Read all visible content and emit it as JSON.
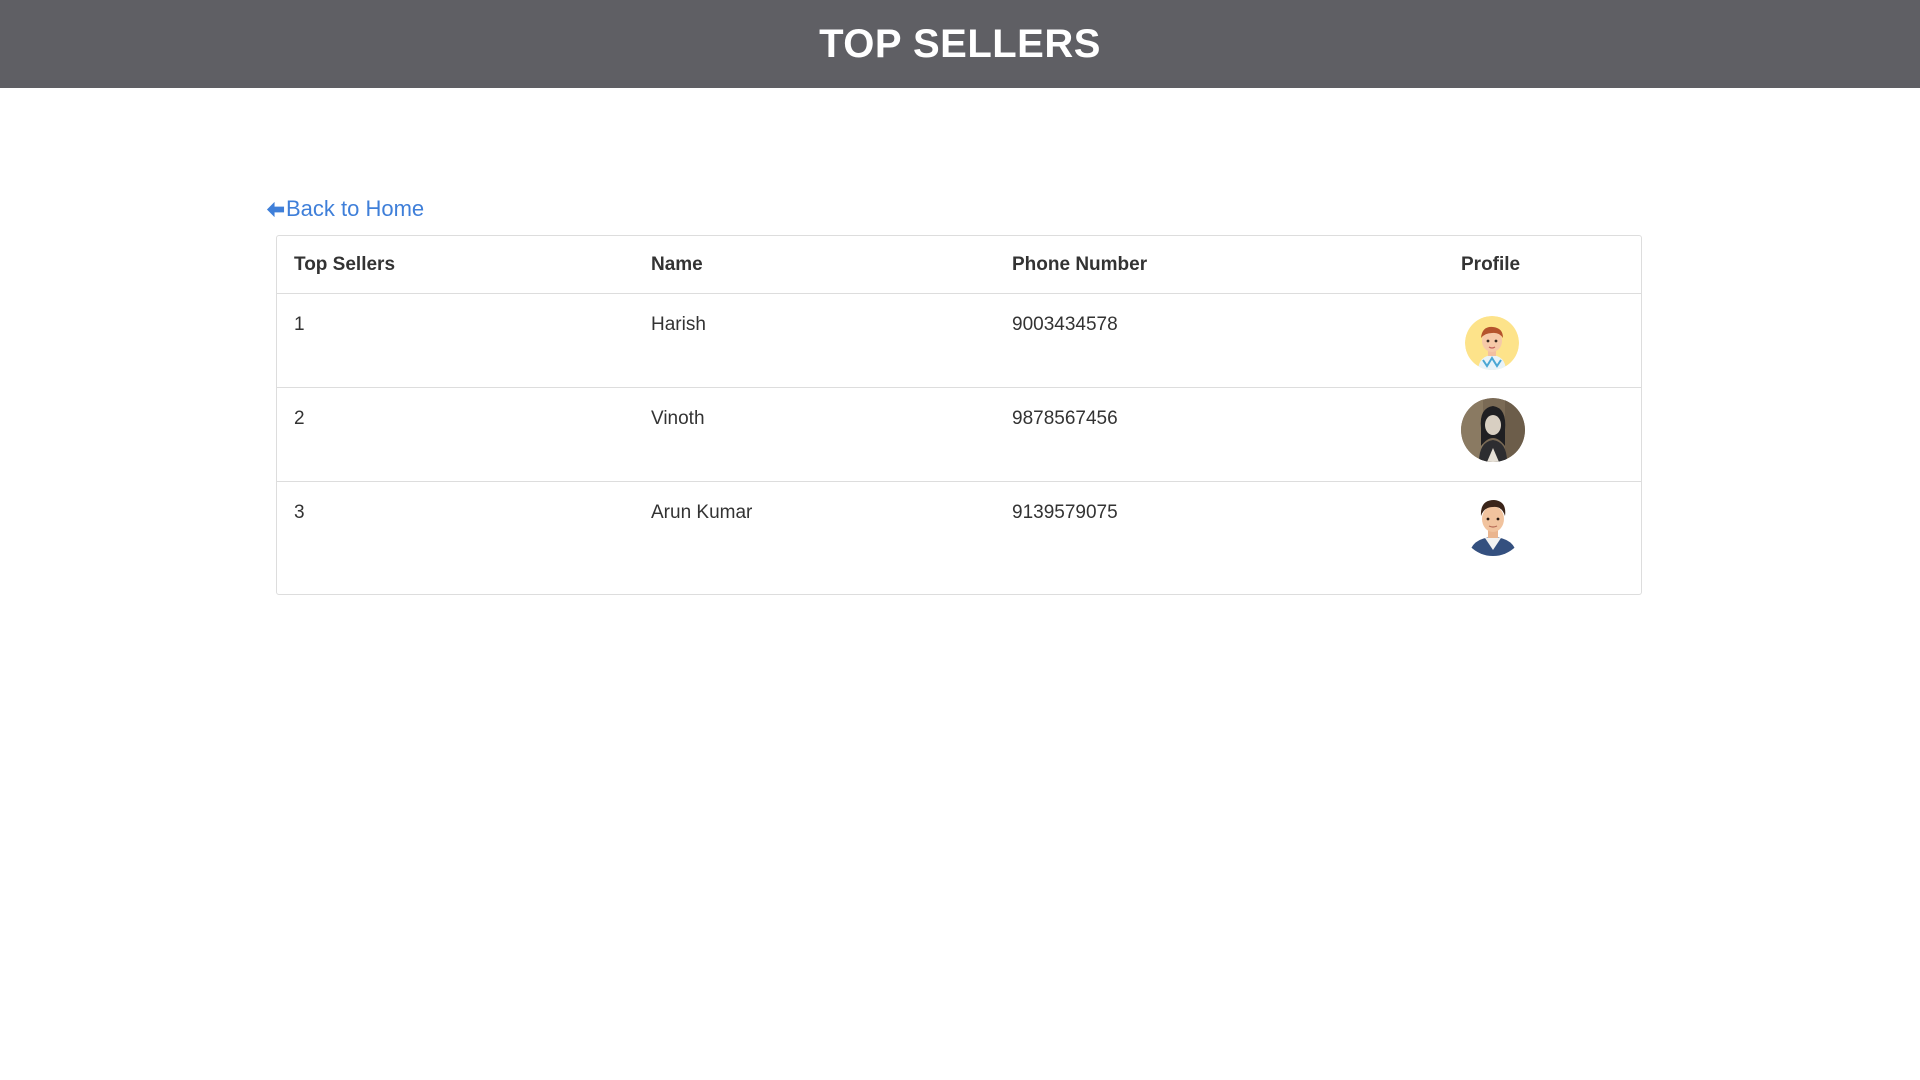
{
  "header": {
    "title": "TOP SELLERS"
  },
  "nav": {
    "back_label": "Back to Home",
    "back_icon": "arrow-left-icon"
  },
  "table": {
    "columns": [
      "Top Sellers",
      "Name",
      "Phone Number",
      "Profile"
    ],
    "rows": [
      {
        "rank": "1",
        "name": "Harish",
        "phone": "9003434578",
        "avatar": "cartoon-boy-avatar"
      },
      {
        "rank": "2",
        "name": "Vinoth",
        "phone": "9878567456",
        "avatar": "photo-avatar"
      },
      {
        "rank": "3",
        "name": "Arun Kumar",
        "phone": "9139579075",
        "avatar": "cartoon-man-avatar"
      }
    ]
  },
  "colors": {
    "header_bg": "#5f5f64",
    "link": "#3f7fd9",
    "border": "#dddddd"
  }
}
